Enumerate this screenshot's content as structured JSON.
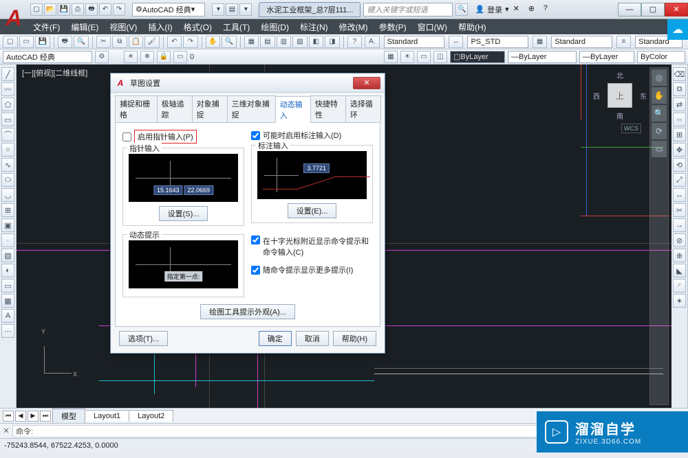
{
  "title": {
    "workspace": "AutoCAD 经典",
    "docTab": "水泥工业框架_总7层111...",
    "searchPlaceholder": "键入关键字或短语",
    "login": "登录"
  },
  "menubar": [
    "文件(F)",
    "编辑(E)",
    "视图(V)",
    "插入(I)",
    "格式(O)",
    "工具(T)",
    "绘图(D)",
    "标注(N)",
    "修改(M)",
    "参数(P)",
    "窗口(W)",
    "帮助(H)"
  ],
  "ribbon": {
    "standards": [
      "Standard",
      "PS_STD",
      "Standard",
      "Standard"
    ]
  },
  "ribbon2": {
    "workspace": "AutoCAD 经典",
    "zero": "0",
    "layerProps": [
      "ByLayer",
      "ByLayer",
      "ByLayer",
      "ByColor"
    ]
  },
  "canvas": {
    "docLabel": "[一][俯视][二维线框]",
    "viewcube": {
      "face": "上",
      "n": "北",
      "s": "南",
      "e": "东",
      "w": "西"
    },
    "wcs": "WCS",
    "ucs": {
      "x": "X",
      "y": "Y"
    }
  },
  "dialog": {
    "title": "草图设置",
    "tabs": [
      "捕捉和栅格",
      "极轴追踪",
      "对象捕捉",
      "三维对象捕捉",
      "动态输入",
      "快捷特性",
      "选择循环"
    ],
    "activeTab": 4,
    "checkboxes": {
      "enablePointer": "启用指针输入(P)",
      "enableDim": "可能时启用标注输入(D)",
      "crosshairPrompt": "在十字光标附近显示命令提示和命令输入(C)",
      "morePrompt": "随命令提示显示更多提示(I)"
    },
    "groups": {
      "pointerInput": "指针输入",
      "dimInput": "标注输入",
      "dynamicPrompt": "动态提示"
    },
    "previews": {
      "pointerCoords": [
        "15.1643",
        "22.0669"
      ],
      "dimValue": "3.7721",
      "promptHint": "指定第一点:"
    },
    "buttons": {
      "settingsS": "设置(S)...",
      "settingsE": "设置(E)...",
      "appearance": "绘图工具提示外观(A)...",
      "options": "选项(T)...",
      "ok": "确定",
      "cancel": "取消",
      "help": "帮助(H)"
    }
  },
  "layoutTabs": [
    "模型",
    "Layout1",
    "Layout2"
  ],
  "command": {
    "label": "命令:"
  },
  "status": {
    "coords": "-75243.8544, 67522.4253, 0.0000"
  },
  "watermark": {
    "brand": "溜溜自学",
    "url": "ZIXUE.3D66.COM"
  }
}
